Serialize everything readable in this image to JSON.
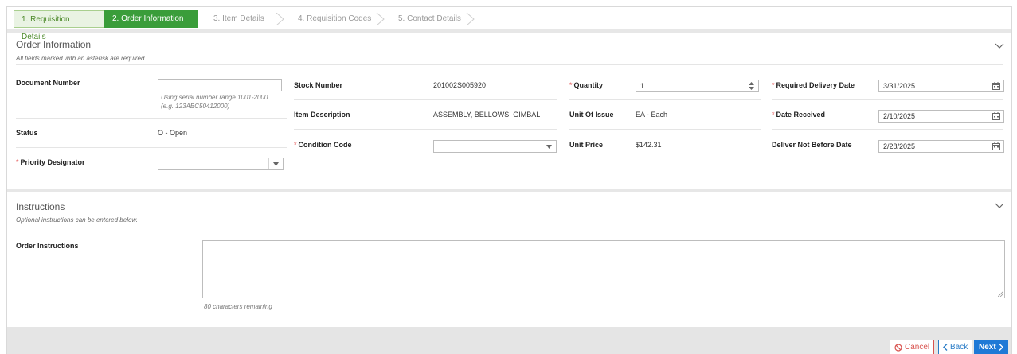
{
  "steps": [
    {
      "label": "1. Requisition Details",
      "state": "done"
    },
    {
      "label": "2. Order Information",
      "state": "active"
    },
    {
      "label": "3. Item Details",
      "state": "pending"
    },
    {
      "label": "4. Requisition Codes",
      "state": "pending"
    },
    {
      "label": "5. Contact Details",
      "state": "pending"
    }
  ],
  "order_info": {
    "title": "Order Information",
    "subtitle": "All fields marked with an asterisk are required.",
    "document_number": {
      "label": "Document Number",
      "value": "",
      "hint1": "Using serial number range 1001-2000",
      "hint2": "(e.g. 123ABC50412000)"
    },
    "status": {
      "label": "Status",
      "value": "O - Open"
    },
    "priority_designator": {
      "label": "Priority Designator",
      "value": ""
    },
    "stock_number": {
      "label": "Stock Number",
      "value": "201002S005920"
    },
    "item_description": {
      "label": "Item Description",
      "value": "ASSEMBLY, BELLOWS, GIMBAL"
    },
    "condition_code": {
      "label": "Condition Code",
      "value": ""
    },
    "quantity": {
      "label": "Quantity",
      "value": "1"
    },
    "unit_of_issue": {
      "label": "Unit Of Issue",
      "value": "EA - Each"
    },
    "unit_price": {
      "label": "Unit Price",
      "value": "$142.31"
    },
    "required_delivery_date": {
      "label": "Required Delivery Date",
      "value": "3/31/2025"
    },
    "date_received": {
      "label": "Date Received",
      "value": "2/10/2025"
    },
    "deliver_not_before_date": {
      "label": "Deliver Not Before Date",
      "value": "2/28/2025"
    }
  },
  "instructions": {
    "title": "Instructions",
    "subtitle": "Optional instructions can be entered below.",
    "label": "Order Instructions",
    "value": "",
    "remaining": "80 characters remaining"
  },
  "footer": {
    "cancel_label": "Cancel",
    "back_label": "Back",
    "next_label": "Next"
  },
  "colors": {
    "accent": "#3a9d3a",
    "required": "#e03a3a",
    "primary": "#1f79d6",
    "danger": "#d9534f"
  }
}
